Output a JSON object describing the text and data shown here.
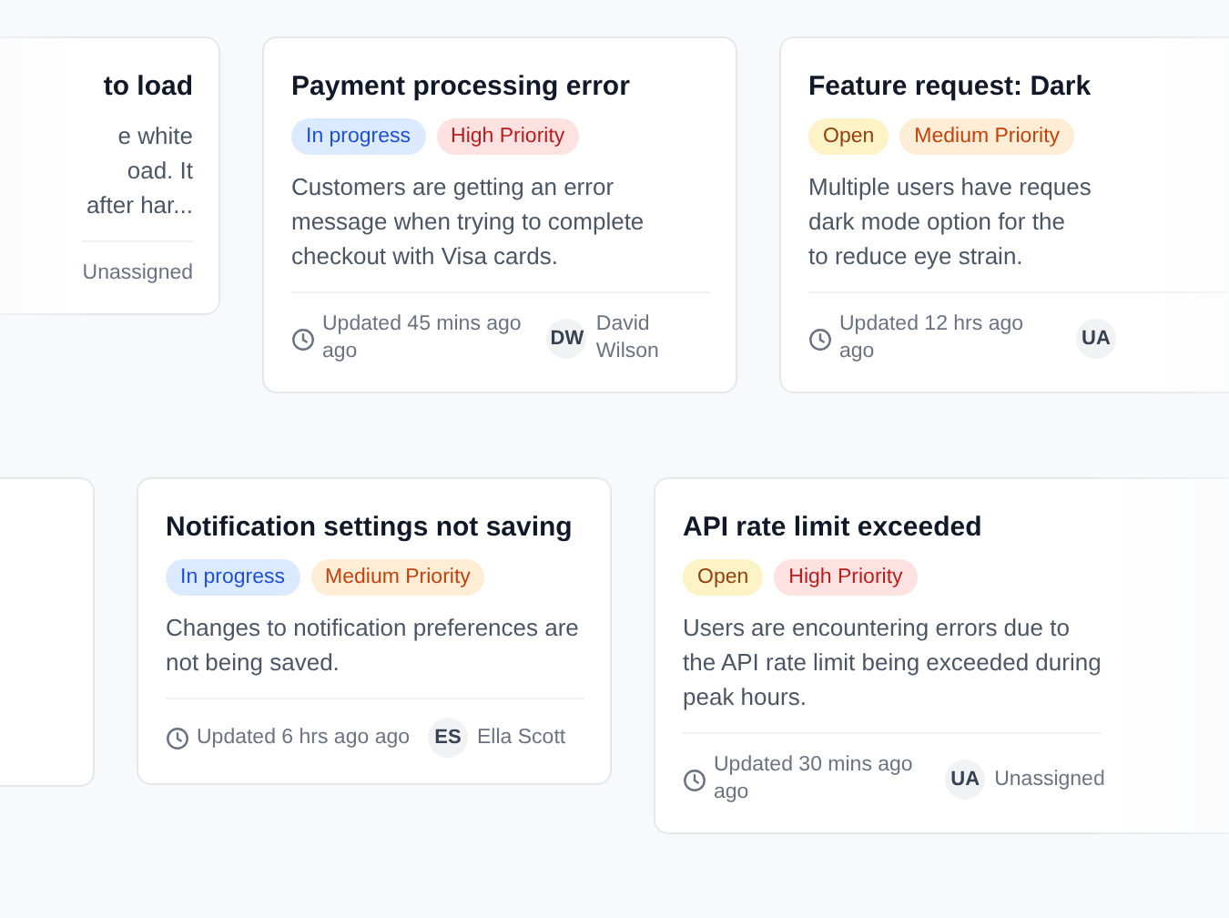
{
  "rows": [
    {
      "cards": [
        {
          "kind": "partial_left",
          "title": "to load",
          "description": "e white\noad. It\nafter har...",
          "assignee": {
            "name": "Unassigned"
          }
        },
        {
          "kind": "full",
          "title": "Payment processing error",
          "badges": [
            {
              "label": "In progress",
              "color": "#1d4ed8"
            },
            {
              "label": "High Priority",
              "color": "#b91c1c"
            }
          ],
          "description": "Customers are getting an error message when trying to complete checkout with Visa cards.",
          "updated": "Updated 45 mins ago ago",
          "assignee": {
            "initials": "DW",
            "name": "David Wilson"
          }
        },
        {
          "kind": "partial_right",
          "title": "Feature request: Dark",
          "badges": [
            {
              "label": "Open",
              "color": "#92400e"
            },
            {
              "label": "Medium Priority",
              "color": "#c2410c"
            }
          ],
          "description": "Multiple users have reques\ndark mode option for the\nto reduce eye strain.",
          "updated": "Updated 12 hrs ago ago",
          "assignee": {
            "initials": "UA"
          }
        }
      ]
    },
    {
      "cards": [
        {
          "kind": "partial_left"
        },
        {
          "kind": "full",
          "title": "Notification settings not saving",
          "badges": [
            {
              "label": "In progress",
              "color": "#1d4ed8"
            },
            {
              "label": "Medium Priority",
              "color": "#c2410c"
            }
          ],
          "description": "Changes to notification preferences are not being saved.",
          "updated": "Updated 6 hrs ago ago",
          "assignee": {
            "initials": "ES",
            "name": "Ella Scott"
          }
        },
        {
          "kind": "partial_right",
          "title": "API rate limit exceeded",
          "badges": [
            {
              "label": "Open",
              "color": "#92400e"
            },
            {
              "label": "High Priority",
              "color": "#b91c1c"
            }
          ],
          "description": "Users are encountering errors due to the API rate limit being exceeded during peak hours.",
          "updated": "Updated 30 mins ago ago",
          "assignee": {
            "initials": "UA",
            "name": "Unassigned"
          }
        }
      ]
    }
  ]
}
